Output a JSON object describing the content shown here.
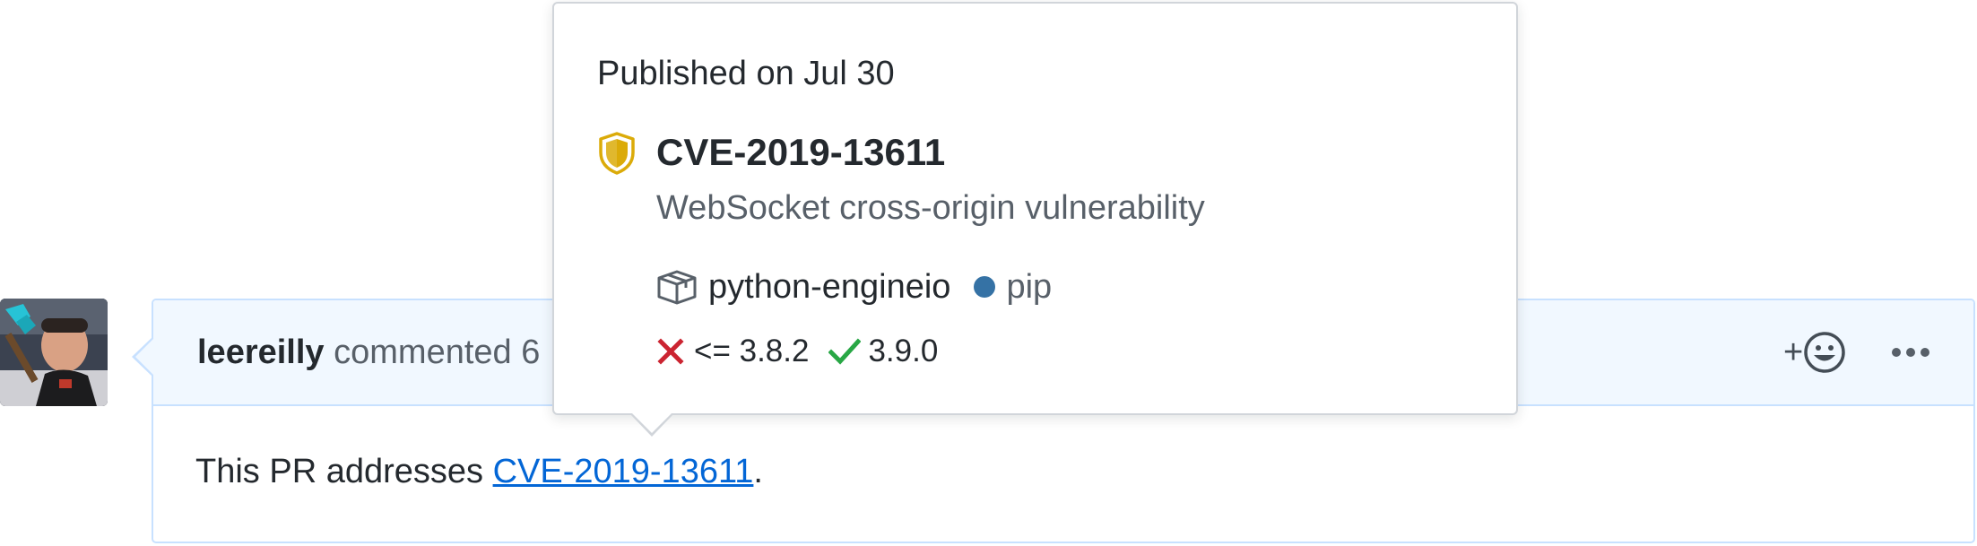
{
  "comment": {
    "author": "leereilly",
    "action": "commented 6",
    "reaction_label": "+",
    "body_prefix": "This PR addresses ",
    "body_link": "CVE-2019-13611",
    "body_suffix": "."
  },
  "popover": {
    "published": "Published on Jul 30",
    "cve_id": "CVE-2019-13611",
    "description": "WebSocket cross-origin vulnerability",
    "package": "python-engineio",
    "ecosystem": "pip",
    "ecosystem_color": "#3572a5",
    "vulnerable_range": "<= 3.8.2",
    "patched_version": "3.9.0",
    "severity_color": "#dbab09"
  },
  "icons": {
    "avatar": "user-avatar",
    "shield": "shield-icon",
    "package": "package-icon",
    "vulnerable": "x-icon",
    "patched": "check-icon",
    "reaction": "smiley-icon",
    "more": "kebab-horizontal-icon"
  }
}
